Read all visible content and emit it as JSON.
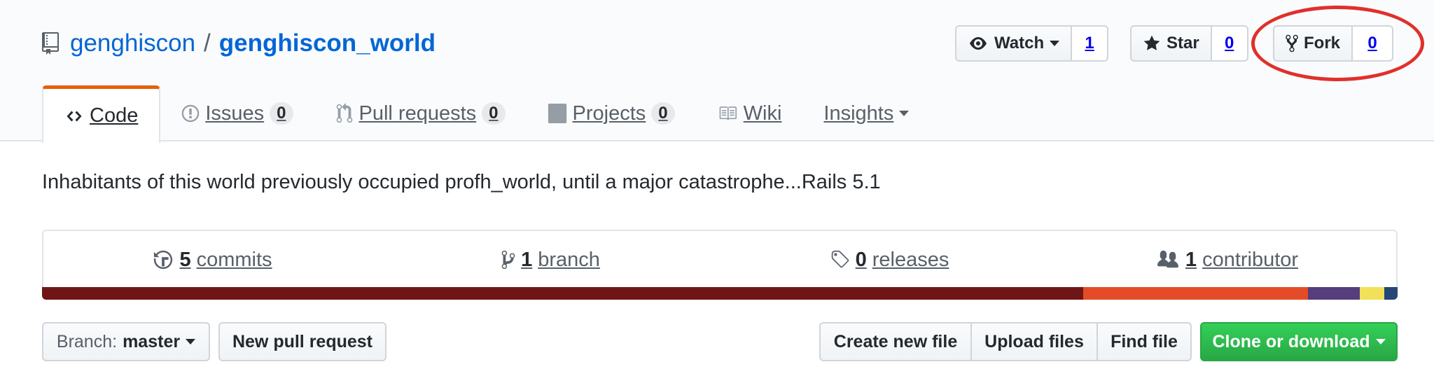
{
  "repo": {
    "owner": "genghiscon",
    "separator": "/",
    "name": "genghiscon_world"
  },
  "actions": {
    "watch": {
      "label": "Watch",
      "count": "1"
    },
    "star": {
      "label": "Star",
      "count": "0"
    },
    "fork": {
      "label": "Fork",
      "count": "0"
    }
  },
  "nav": {
    "code": "Code",
    "issues": {
      "label": "Issues",
      "count": "0"
    },
    "pulls": {
      "label": "Pull requests",
      "count": "0"
    },
    "projects": {
      "label": "Projects",
      "count": "0"
    },
    "wiki": "Wiki",
    "insights": "Insights"
  },
  "description": "Inhabitants of this world previously occupied profh_world, until a major catastrophe...Rails 5.1",
  "summary": {
    "commits": {
      "count": "5",
      "label": "commits"
    },
    "branch": {
      "count": "1",
      "label": "branch"
    },
    "releases": {
      "count": "0",
      "label": "releases"
    },
    "contributors": {
      "count": "1",
      "label": "contributor"
    }
  },
  "language_bar": [
    {
      "color": "#701516",
      "share": 0.768
    },
    {
      "color": "#e34c26",
      "share": 0.166
    },
    {
      "color": "#563d7c",
      "share": 0.038
    },
    {
      "color": "#f1e05a",
      "share": 0.018
    },
    {
      "color": "#244776",
      "share": 0.01
    }
  ],
  "filebar": {
    "branch_label": "Branch:",
    "branch_value": "master",
    "new_pr": "New pull request",
    "create_file": "Create new file",
    "upload": "Upload files",
    "find": "Find file",
    "clone": "Clone or download"
  },
  "colors": {
    "link": "#0366d6",
    "nav_selected_accent": "#e36209",
    "annotation_circle": "#e0302b",
    "primary_button": "#28a745"
  }
}
